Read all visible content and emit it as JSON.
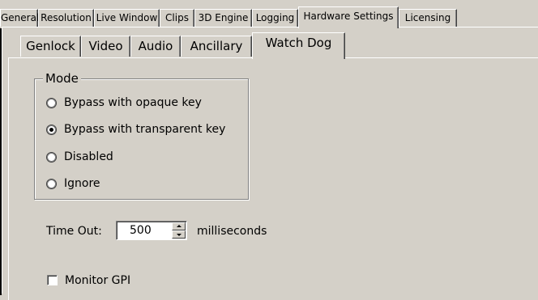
{
  "outer_tabs": [
    {
      "label": "General"
    },
    {
      "label": "Resolution"
    },
    {
      "label": "Live Window"
    },
    {
      "label": "Clips"
    },
    {
      "label": "3D Engine"
    },
    {
      "label": "Logging"
    },
    {
      "label": "Hardware Settings",
      "selected": true
    },
    {
      "label": "Licensing"
    }
  ],
  "inner_tabs": [
    {
      "label": "Genlock"
    },
    {
      "label": "Video"
    },
    {
      "label": "Audio"
    },
    {
      "label": "Ancillary"
    },
    {
      "label": "Watch Dog",
      "selected": true
    }
  ],
  "mode_group": {
    "title": "Mode",
    "options": [
      {
        "label": "Bypass with opaque key",
        "checked": false
      },
      {
        "label": "Bypass with transparent key",
        "checked": true
      },
      {
        "label": "Disabled",
        "checked": false
      },
      {
        "label": "Ignore",
        "checked": false
      }
    ]
  },
  "timeout": {
    "label": "Time Out:",
    "value": "500",
    "unit": "milliseconds"
  },
  "monitor_gpi": {
    "label": "Monitor GPI",
    "checked": false
  }
}
